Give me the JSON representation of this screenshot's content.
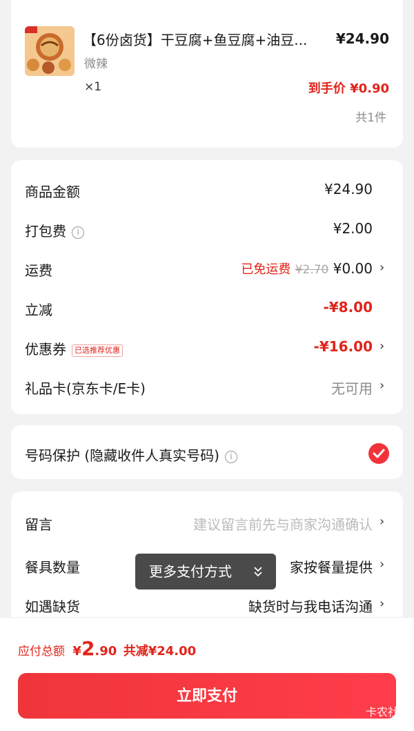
{
  "product": {
    "title": "【6份卤货】干豆腐+鱼豆腐+油豆...",
    "price": "¥24.90",
    "variant": "微辣",
    "quantity": "×1",
    "final_price": "到手价 ¥0.90",
    "count": "共1件"
  },
  "fees": {
    "goods": {
      "label": "商品金额",
      "value": "¥24.90"
    },
    "packing": {
      "label": "打包费",
      "value": "¥2.00"
    },
    "shipping": {
      "label": "运费",
      "status": "已免运费",
      "original": "¥2.70",
      "value": "¥0.00"
    },
    "discount": {
      "label": "立减",
      "value": "-¥8.00"
    },
    "coupon": {
      "label": "优惠券",
      "tag": "已选推荐优惠",
      "value": "-¥16.00"
    },
    "giftcard": {
      "label": "礼品卡(京东卡/E卡)",
      "value": "无可用"
    }
  },
  "privacy": {
    "label": "号码保护 (隐藏收件人真实号码)"
  },
  "notes": {
    "message": {
      "label": "留言",
      "placeholder": "建议留言前先与商家沟通确认"
    },
    "utensils": {
      "label": "餐具数量",
      "value": "家按餐量提供"
    },
    "outofstock": {
      "label": "如遇缺货",
      "value": "缺货时与我电话沟通"
    }
  },
  "tooltip": {
    "label": "更多支付方式"
  },
  "footer": {
    "total_label": "应付总额",
    "currency": "¥",
    "total_int": "2",
    "total_dec": ".90",
    "saved": "共减¥24.00",
    "pay_label": "立即支付",
    "watermark": "卡农社区"
  },
  "colors": {
    "accent": "#e2231a",
    "button": "#f0353a"
  },
  "icons": {
    "arrow": "chevron-right-icon",
    "info": "info-icon",
    "check": "check-icon"
  }
}
